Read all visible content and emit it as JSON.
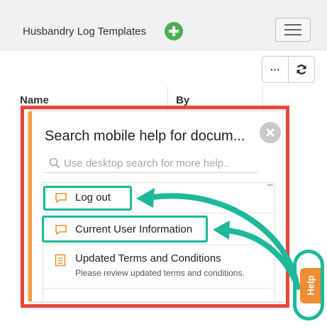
{
  "header": {
    "title": "Husbandry Log Templates",
    "add_icon": "plus-circle-icon",
    "menu_icon": "hamburger-menu-icon"
  },
  "toolbar": {
    "more_label": "···",
    "refresh_icon": "refresh-icon"
  },
  "table": {
    "columns": [
      "Name",
      "By"
    ]
  },
  "help_popup": {
    "title": "Search mobile help for docum...",
    "search_placeholder": "Use desktop search for more help..",
    "close_icon": "close-icon",
    "results": [
      {
        "label": "Log out",
        "icon": "chat-bubble-icon",
        "description": ""
      },
      {
        "label": "Current User Information",
        "icon": "chat-bubble-icon",
        "description": ""
      },
      {
        "label": "Updated Terms and Conditions",
        "icon": "document-icon",
        "description": "Please review updated terms and conditions."
      }
    ]
  },
  "help_tab": {
    "label": "Help"
  },
  "colors": {
    "accent_orange": "#f08d33",
    "annotation_teal": "#1fb89a",
    "annotation_red": "#e8473b",
    "add_green": "#4caf50"
  }
}
